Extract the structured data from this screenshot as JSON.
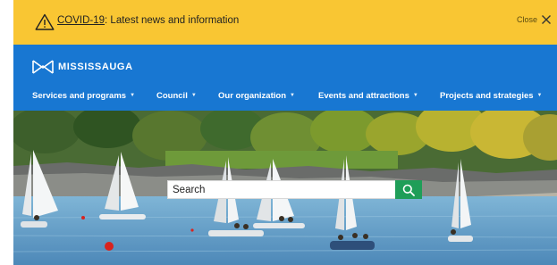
{
  "alert": {
    "icon": "warning-triangle-icon",
    "link_text": "COVID-19",
    "message": ": Latest news and information",
    "close_label": "Close",
    "close_icon": "close-icon",
    "background_color": "#f9c633"
  },
  "header": {
    "brand": "MISSISSAUGA",
    "logo_icon": "mississauga-logo-icon",
    "background_color": "#1877d2"
  },
  "nav": {
    "items": [
      {
        "label": "Services and programs"
      },
      {
        "label": "Council"
      },
      {
        "label": "Our organization"
      },
      {
        "label": "Events and attractions"
      },
      {
        "label": "Projects and strategies"
      }
    ],
    "caret_icon": "caret-down-icon"
  },
  "hero": {
    "search_placeholder": "Search",
    "search_icon": "search-icon",
    "search_button_color": "#1f9e58"
  }
}
